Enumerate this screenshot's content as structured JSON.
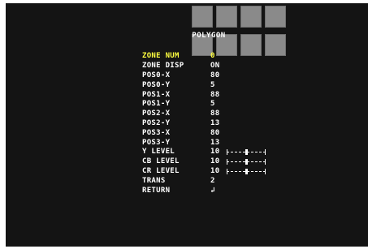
{
  "osd": {
    "title": "POLYGON",
    "zone_grid_cells": 8,
    "selected_color": "#ffff40",
    "text_color": "#ffffff",
    "background_color": "#141414",
    "items": [
      {
        "label": "ZONE NUM",
        "value": "0",
        "selected": true
      },
      {
        "label": "ZONE DISP",
        "value": "ON"
      },
      {
        "label": "POS0-X",
        "value": "80"
      },
      {
        "label": "POS0-Y",
        "value": "5"
      },
      {
        "label": "POS1-X",
        "value": "88"
      },
      {
        "label": "POS1-Y",
        "value": "5"
      },
      {
        "label": "POS2-X",
        "value": "88"
      },
      {
        "label": "POS2-Y",
        "value": "13"
      },
      {
        "label": "POS3-X",
        "value": "80"
      },
      {
        "label": "POS3-Y",
        "value": "13"
      },
      {
        "label": "Y LEVEL",
        "value": "10",
        "slider": 0.5
      },
      {
        "label": "CB LEVEL",
        "value": "10",
        "slider": 0.5
      },
      {
        "label": "CR LEVEL",
        "value": "10",
        "slider": 0.5
      },
      {
        "label": "TRANS",
        "value": "2"
      },
      {
        "label": "RETURN",
        "value": "↲"
      }
    ]
  }
}
